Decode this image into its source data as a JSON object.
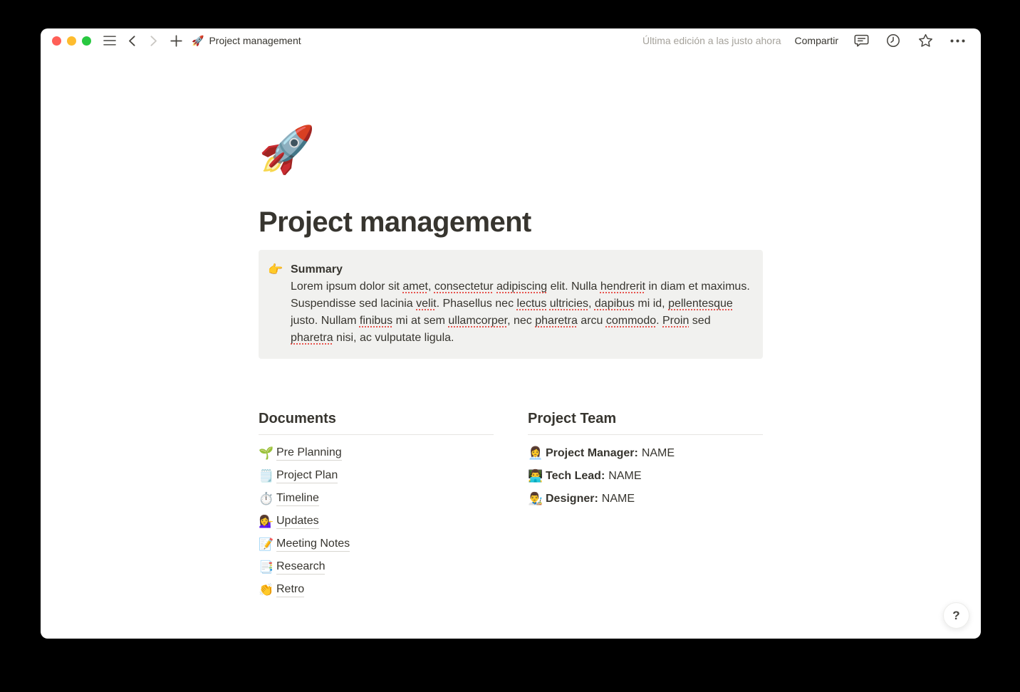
{
  "colors": {
    "desktop_background": "#000000",
    "window_background": "#ffffff",
    "text": "#37352f",
    "muted_text": "#a5a29b",
    "callout_background": "#f1f1ef",
    "divider": "#e6e5e2",
    "link_underline": "#d8d6d1",
    "spellcheck_underline": "#e8544e",
    "traffic_light_close": "#ff5f57",
    "traffic_light_minimize": "#febc2e",
    "traffic_light_zoom": "#28c840"
  },
  "titlebar": {
    "breadcrumb_icon": "🚀",
    "breadcrumb_title": "Project management",
    "last_edited": "Última edición a las justo ahora",
    "share_label": "Compartir",
    "icons": {
      "menu": "hamburger-menu",
      "back": "chevron-left",
      "forward": "chevron-right",
      "new_tab": "plus",
      "comments": "speech-bubble",
      "history": "clock",
      "favorite": "star-outline",
      "more": "ellipsis-dots"
    }
  },
  "page": {
    "icon": "🚀",
    "title": "Project management",
    "callout": {
      "icon": "👉",
      "heading": "Summary",
      "segments": [
        {
          "t": "Lorem ipsum dolor sit ",
          "misspelled": false
        },
        {
          "t": "amet",
          "misspelled": true
        },
        {
          "t": ", ",
          "misspelled": false
        },
        {
          "t": "consectetur",
          "misspelled": true
        },
        {
          "t": " ",
          "misspelled": false
        },
        {
          "t": "adipiscing",
          "misspelled": true
        },
        {
          "t": " elit. Nulla ",
          "misspelled": false
        },
        {
          "t": "hendrerit",
          "misspelled": true
        },
        {
          "t": " in diam et maximus. Suspendisse sed lacinia ",
          "misspelled": false
        },
        {
          "t": "velit",
          "misspelled": true
        },
        {
          "t": ". Phasellus nec ",
          "misspelled": false
        },
        {
          "t": "lectus",
          "misspelled": true
        },
        {
          "t": " ",
          "misspelled": false
        },
        {
          "t": "ultricies",
          "misspelled": true
        },
        {
          "t": ", ",
          "misspelled": false
        },
        {
          "t": "dapibus",
          "misspelled": true
        },
        {
          "t": " mi id, ",
          "misspelled": false
        },
        {
          "t": "pellentesque",
          "misspelled": true
        },
        {
          "t": " justo. Nullam ",
          "misspelled": false
        },
        {
          "t": "finibus",
          "misspelled": true
        },
        {
          "t": " mi at sem ",
          "misspelled": false
        },
        {
          "t": "ullamcorper",
          "misspelled": true
        },
        {
          "t": ", nec ",
          "misspelled": false
        },
        {
          "t": "pharetra",
          "misspelled": true
        },
        {
          "t": " arcu ",
          "misspelled": false
        },
        {
          "t": "commodo",
          "misspelled": true
        },
        {
          "t": ". ",
          "misspelled": false
        },
        {
          "t": "Proin",
          "misspelled": true
        },
        {
          "t": " sed ",
          "misspelled": false
        },
        {
          "t": "pharetra",
          "misspelled": true
        },
        {
          "t": " nisi, ac vulputate ligula.",
          "misspelled": false
        }
      ]
    },
    "documents": {
      "heading": "Documents",
      "items": [
        {
          "icon": "🌱",
          "label": "Pre Planning"
        },
        {
          "icon": "🗒️",
          "label": "Project Plan"
        },
        {
          "icon": "⏱️",
          "label": "Timeline"
        },
        {
          "icon": "💁‍♀️",
          "label": "Updates"
        },
        {
          "icon": "📝",
          "label": "Meeting Notes"
        },
        {
          "icon": "📑",
          "label": "Research"
        },
        {
          "icon": "👏",
          "label": "Retro"
        }
      ]
    },
    "team": {
      "heading": "Project Team",
      "members": [
        {
          "icon": "👩‍💼",
          "role": "Project Manager:",
          "name": "NAME"
        },
        {
          "icon": "👨‍💻",
          "role": "Tech Lead:",
          "name": "NAME"
        },
        {
          "icon": "👨‍🎨",
          "role": "Designer:",
          "name": "NAME"
        }
      ]
    },
    "help_label": "?"
  }
}
